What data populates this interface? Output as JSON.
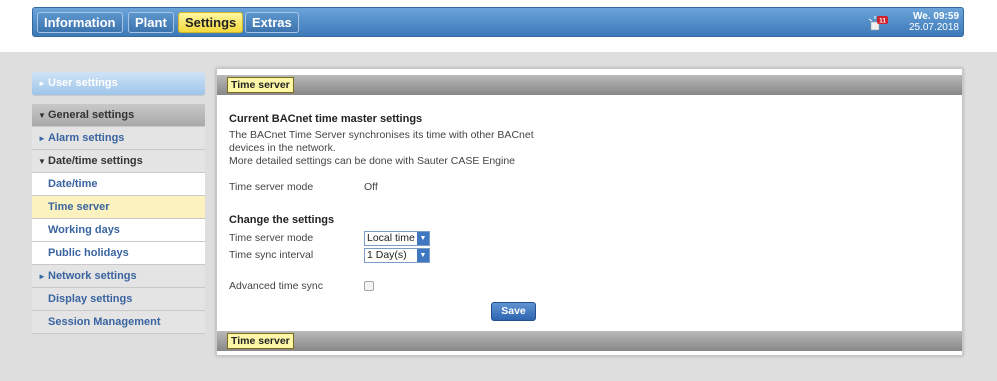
{
  "nav": {
    "tabs": [
      {
        "label": "Information"
      },
      {
        "label": "Plant"
      },
      {
        "label": "Settings"
      },
      {
        "label": "Extras"
      }
    ],
    "alarm_count": "11",
    "clock_day": "We. 09:59",
    "clock_date": "25.07.2018"
  },
  "sidebar": {
    "user_settings": "User settings",
    "general_settings": "General settings",
    "alarm_settings": "Alarm settings",
    "datetime_settings": "Date/time settings",
    "items": [
      {
        "label": "Date/time"
      },
      {
        "label": "Time server"
      },
      {
        "label": "Working days"
      },
      {
        "label": "Public holidays"
      }
    ],
    "network_settings": "Network settings",
    "display_settings": "Display settings",
    "session_management": "Session Management"
  },
  "panel": {
    "tab_top": "Time server",
    "tab_bottom": "Time server",
    "heading": "Current BACnet time master settings",
    "desc_line1": "The BACnet Time Server synchronises its time with other BACnet",
    "desc_line2": "devices in the network.",
    "desc_line3": "More detailed settings can be done with Sauter CASE Engine",
    "current_mode_label": "Time server mode",
    "current_mode_value": "Off",
    "change_heading": "Change the settings",
    "mode_label": "Time server mode",
    "mode_value": "Local time",
    "interval_label": "Time sync interval",
    "interval_value": "1 Day(s)",
    "advanced_label": "Advanced time sync",
    "advanced_checked": false,
    "save_label": "Save"
  },
  "colors": {
    "nav_bg": "#4a86c5",
    "active_tab": "#f4d93b",
    "selected_item_bg": "#fbf2c0",
    "link": "#3a64a0"
  }
}
